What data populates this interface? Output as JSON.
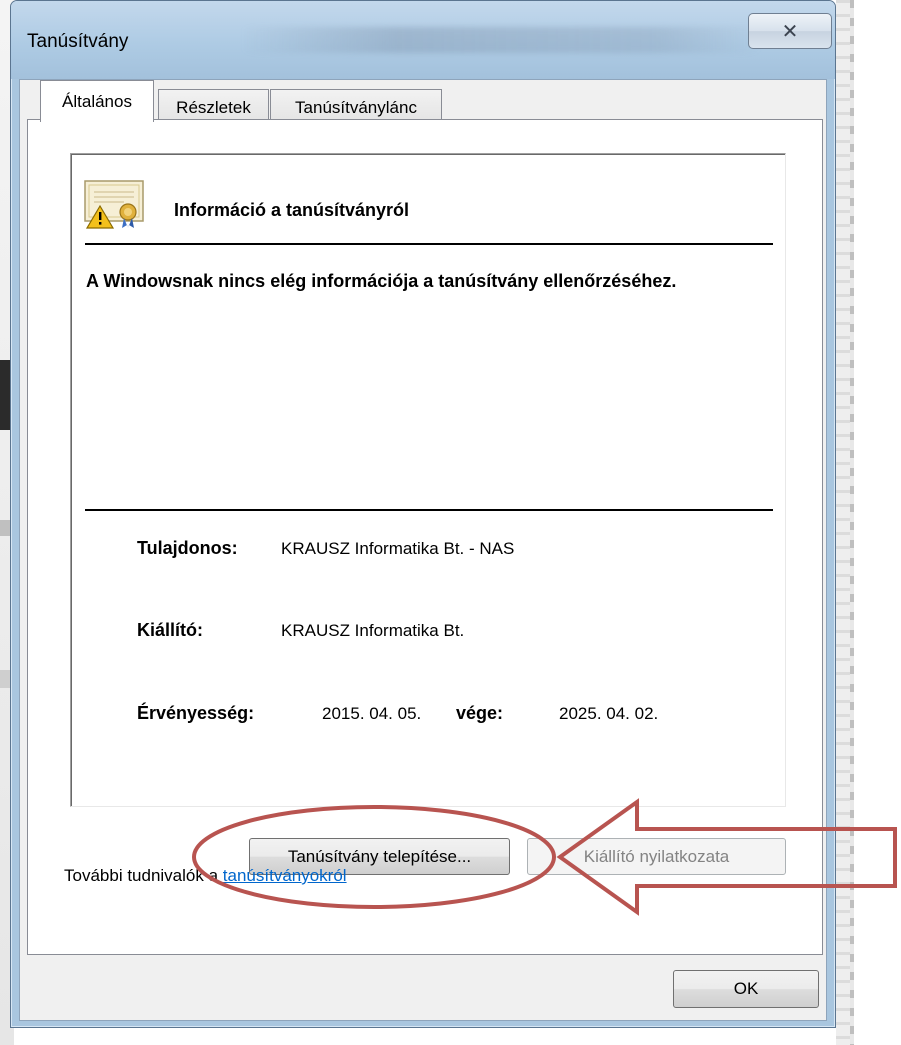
{
  "window": {
    "title": "Tanúsítvány",
    "close_glyph": "✕"
  },
  "tabs": [
    {
      "label": "Általános",
      "active": true
    },
    {
      "label": "Részletek",
      "active": false
    },
    {
      "label": "Tanúsítványlánc",
      "active": false
    }
  ],
  "cert_info": {
    "heading": "Információ a tanúsítványról",
    "warning": "A Windowsnak nincs elég információja a tanúsítvány ellenőrzéséhez.",
    "owner_label": "Tulajdonos:",
    "owner_value": "KRAUSZ Informatika Bt. - NAS",
    "issuer_label": "Kiállító:",
    "issuer_value": "KRAUSZ Informatika Bt.",
    "validity_label": "Érvényesség:",
    "valid_from": "2015. 04. 05.",
    "valid_to_label": "vége:",
    "valid_to": "2025. 04. 02."
  },
  "buttons": {
    "install": "Tanúsítvány telepítése...",
    "issuer_statement": "Kiállító nyilatkozata",
    "ok": "OK"
  },
  "learn_more": {
    "prefix": "További tudnivalók a ",
    "link": "tanúsítványokról"
  },
  "colors": {
    "annotation": "#b85450",
    "link": "#0066cc",
    "titlebar": "#aecbe4"
  },
  "icons": {
    "certificate": "certificate-warning-icon",
    "close": "close-icon"
  }
}
